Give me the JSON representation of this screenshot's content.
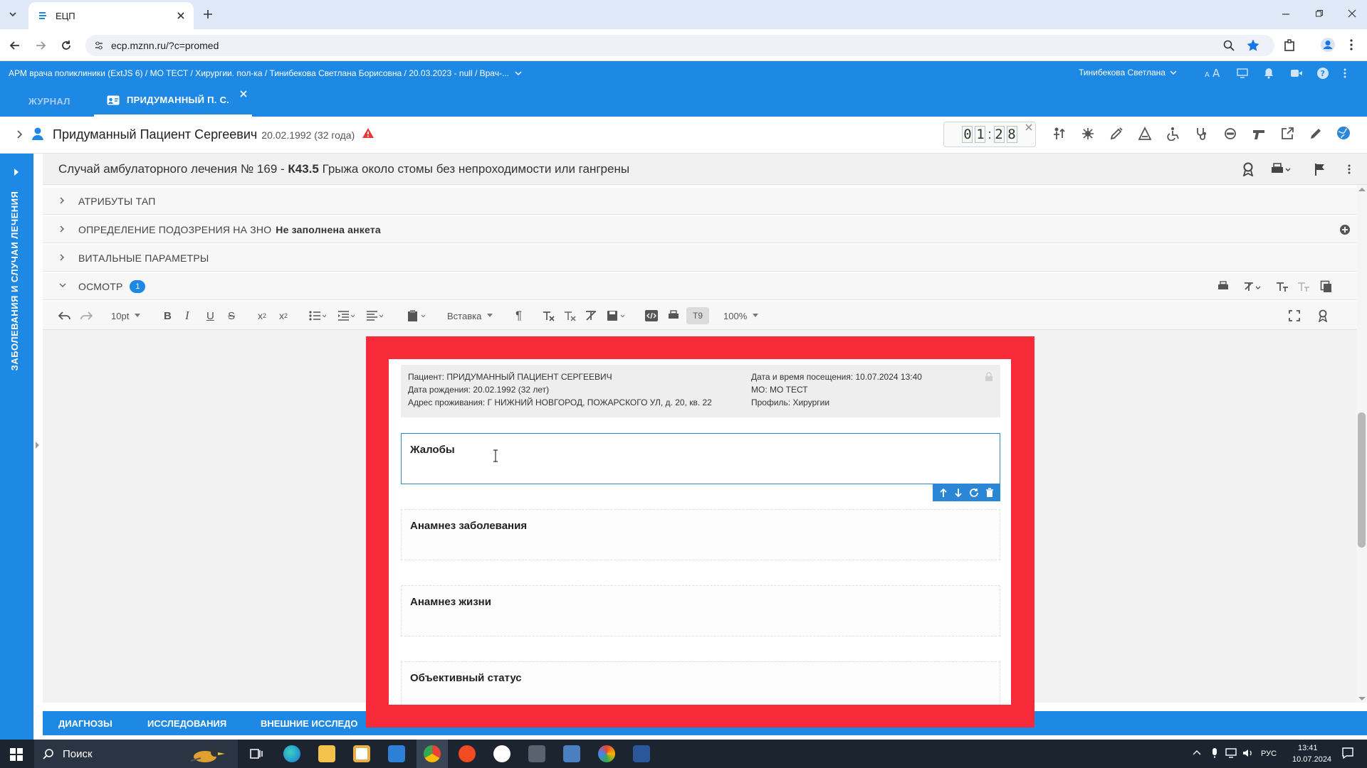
{
  "browser": {
    "tab_title": "ЕЦП",
    "url": "ecp.mznn.ru/?c=promed"
  },
  "app": {
    "breadcrumb": "АРМ врача поликлиники (ExtJS 6) / МО ТЕСТ / Хирургии. пол-ка / Тинибекова Светлана Борисовна / 20.03.2023 - null / Врач-...",
    "user_name": "Тинибекова Светлана",
    "tabs": [
      {
        "label": "ЖУРНАЛ"
      },
      {
        "label": "ПРИДУМАННЫЙ П. С."
      }
    ]
  },
  "patient": {
    "name": "Придуманный Пациент Сергеевич",
    "dob": "20.02.1992 (32 года)",
    "timer": [
      "0",
      "1",
      "2",
      "8"
    ],
    "timer_sep": ":"
  },
  "sidebar": {
    "label": "ЗАБОЛЕВАНИЯ И СЛУЧАИ ЛЕЧЕНИЯ"
  },
  "case": {
    "prefix": "Случай амбулаторного лечения № 169 - ",
    "code": "К43.5",
    "diagnosis": " Грыжа около стомы без непроходимости или гангрены"
  },
  "sections": [
    {
      "label": "АТРИБУТЫ ТАП",
      "extra": ""
    },
    {
      "label": "ОПРЕДЕЛЕНИЕ ПОДОЗРЕНИЯ НА ЗНО",
      "extra": "Не заполнена анкета"
    },
    {
      "label": "ВИТАЛЬНЫЕ ПАРАМЕТРЫ",
      "extra": ""
    },
    {
      "label": "ОСМОТР",
      "badge": "1"
    }
  ],
  "toolbar": {
    "font_size": "10pt",
    "insert": "Вставка",
    "t9": "T9",
    "zoom": "100%"
  },
  "document": {
    "patient": "Пациент: ПРИДУМАННЫЙ ПАЦИЕНТ СЕРГЕЕВИЧ",
    "dob": "Дата рождения: 20.02.1992 (32 лет)",
    "address": "Адрес проживания: Г НИЖНИЙ НОВГОРОД, ПОЖАРСКОГО УЛ, д. 20, кв. 22",
    "visit": "Дата и время посещения: 10.07.2024 13:40",
    "mo": "МО: МО ТЕСТ",
    "profile": "Профиль: Хирургии",
    "fields": [
      {
        "label": "Жалобы"
      },
      {
        "label": "Анамнез заболевания"
      },
      {
        "label": "Анамнез жизни"
      },
      {
        "label": "Объективный статус"
      }
    ]
  },
  "bottom_tabs": [
    {
      "label": "ДИАГНОЗЫ"
    },
    {
      "label": "ИССЛЕДОВАНИЯ"
    },
    {
      "label": "ВНЕШНИЕ ИССЛЕДО"
    }
  ],
  "taskbar": {
    "search": "Поиск",
    "lang": "РУС",
    "time": "13:41",
    "date": "10.07.2024"
  },
  "colors": {
    "brand": "#1e88e5",
    "frame": "#f72a3a",
    "warning": "#e53935"
  }
}
